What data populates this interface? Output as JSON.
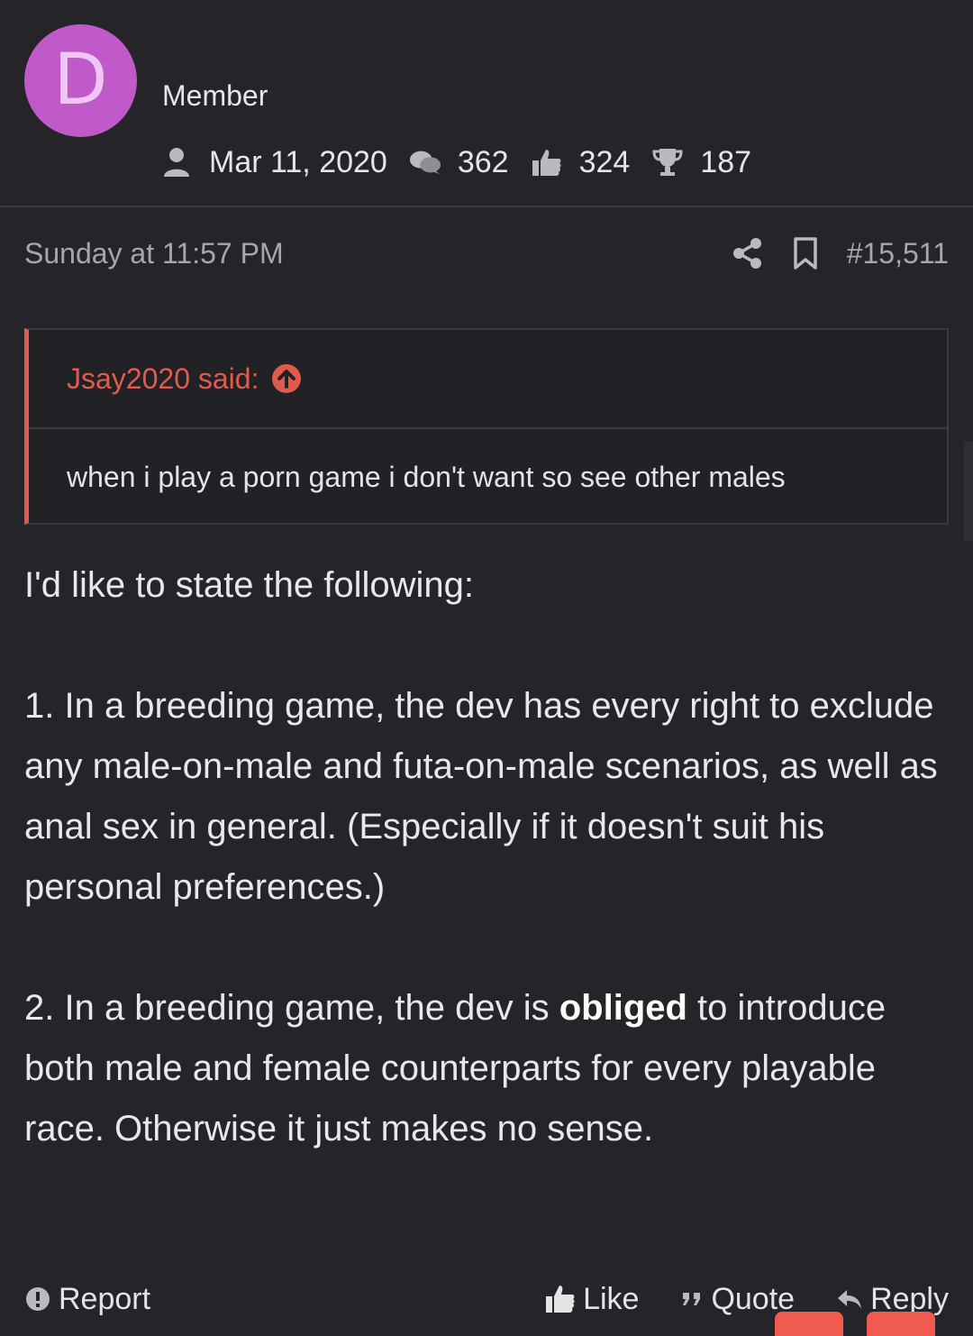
{
  "user": {
    "avatar_letter": "D",
    "avatar_color": "#c05ac8",
    "title": "Member",
    "joined": "Mar 11, 2020",
    "messages": "362",
    "reactions": "324",
    "points": "187"
  },
  "post": {
    "timestamp": "Sunday at 11:57 PM",
    "number": "#15,511",
    "accent_color": "#e15b4c"
  },
  "quote": {
    "author": "Jsay2020 said:",
    "text": "when i play a porn game i don't want so see other males"
  },
  "message": {
    "p1": "I'd like to state the following:",
    "p2": "1. In a breeding game, the dev has every right to exclude any male-on-male and futa-on-male scenarios, as well as anal sex in general. (Especially if it doesn't suit his personal preferences.)",
    "p3_before": "2. In a breeding game, the dev is ",
    "p3_bold": "obliged",
    "p3_after": " to introduce both male and female counterparts for every playable race. Otherwise it just makes no sense."
  },
  "actions": {
    "report": "Report",
    "like": "Like",
    "quote": "Quote",
    "reply": "Reply"
  }
}
